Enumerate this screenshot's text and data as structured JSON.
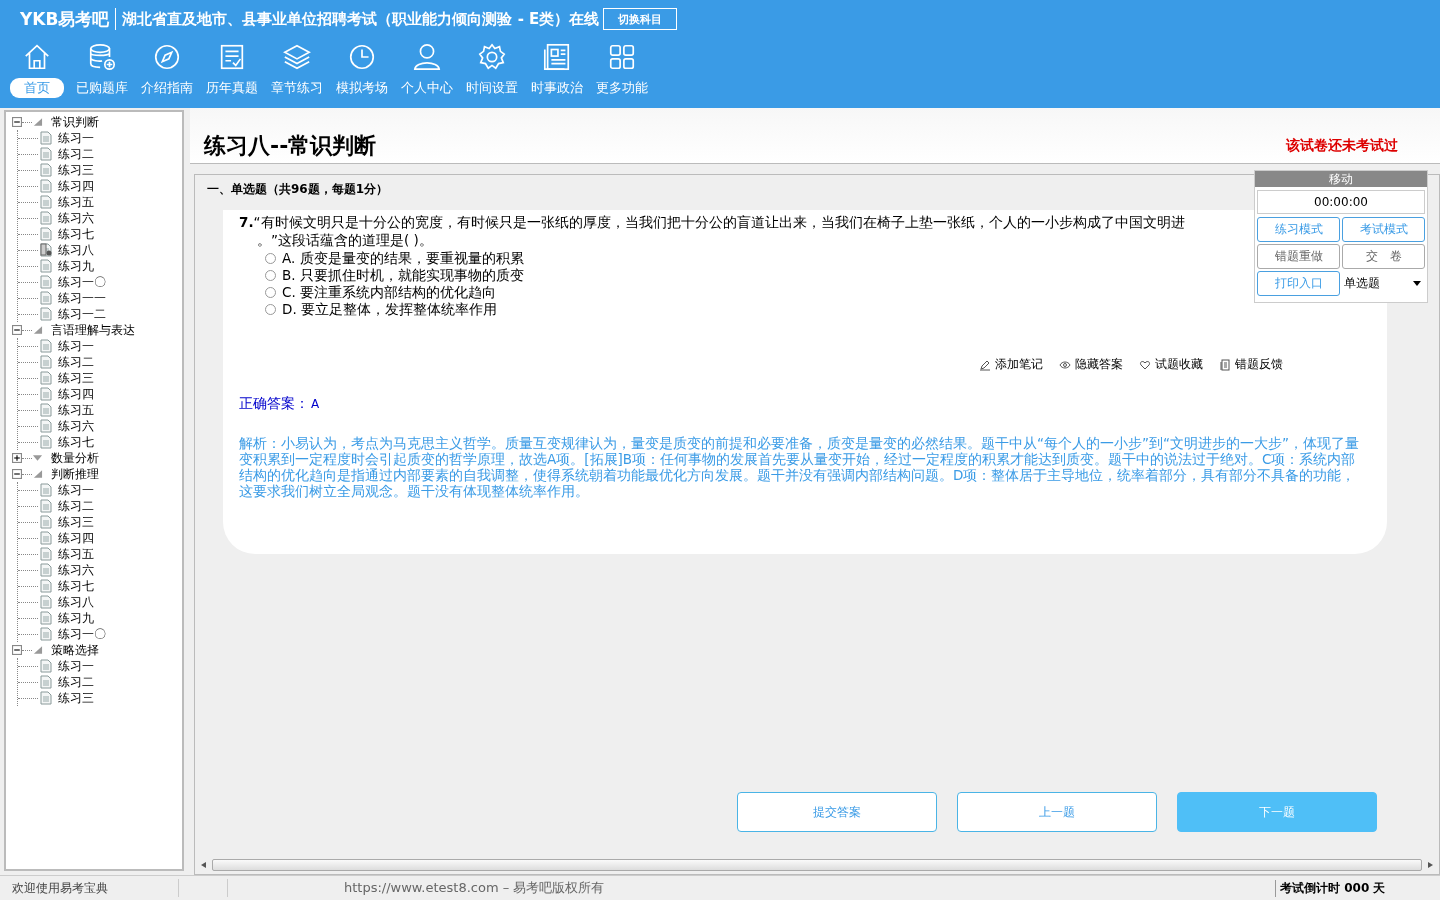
{
  "header": {
    "logo": "YKB易考吧",
    "title": "湖北省直及地市、县事业单位招聘考试（职业能力倾向测验 - E类）在线",
    "switch_button": "切换科目"
  },
  "nav": [
    {
      "label": "首页",
      "selected": true
    },
    {
      "label": "已购题库",
      "selected": false
    },
    {
      "label": "介绍指南",
      "selected": false
    },
    {
      "label": "历年真题",
      "selected": false
    },
    {
      "label": "章节练习",
      "selected": false
    },
    {
      "label": "模拟考场",
      "selected": false
    },
    {
      "label": "个人中心",
      "selected": false
    },
    {
      "label": "时间设置",
      "selected": false
    },
    {
      "label": "时事政治",
      "selected": false
    },
    {
      "label": "更多功能",
      "selected": false
    }
  ],
  "tree": [
    {
      "label": "常识判断",
      "expanded": true,
      "children": [
        {
          "label": "练习一",
          "selected": false
        },
        {
          "label": "练习二",
          "selected": false
        },
        {
          "label": "练习三",
          "selected": false
        },
        {
          "label": "练习四",
          "selected": false
        },
        {
          "label": "练习五",
          "selected": false
        },
        {
          "label": "练习六",
          "selected": false
        },
        {
          "label": "练习七",
          "selected": false
        },
        {
          "label": "练习八",
          "selected": true
        },
        {
          "label": "练习九",
          "selected": false
        },
        {
          "label": "练习一〇",
          "selected": false
        },
        {
          "label": "练习一一",
          "selected": false
        },
        {
          "label": "练习一二",
          "selected": false
        }
      ]
    },
    {
      "label": "言语理解与表达",
      "expanded": true,
      "children": [
        {
          "label": "练习一",
          "selected": false
        },
        {
          "label": "练习二",
          "selected": false
        },
        {
          "label": "练习三",
          "selected": false
        },
        {
          "label": "练习四",
          "selected": false
        },
        {
          "label": "练习五",
          "selected": false
        },
        {
          "label": "练习六",
          "selected": false
        },
        {
          "label": "练习七",
          "selected": false
        }
      ]
    },
    {
      "label": "数量分析",
      "expanded": false
    },
    {
      "label": "判断推理",
      "expanded": true,
      "children": [
        {
          "label": "练习一",
          "selected": false
        },
        {
          "label": "练习二",
          "selected": false
        },
        {
          "label": "练习三",
          "selected": false
        },
        {
          "label": "练习四",
          "selected": false
        },
        {
          "label": "练习五",
          "selected": false
        },
        {
          "label": "练习六",
          "selected": false
        },
        {
          "label": "练习七",
          "selected": false
        },
        {
          "label": "练习八",
          "selected": false
        },
        {
          "label": "练习九",
          "selected": false
        },
        {
          "label": "练习一〇",
          "selected": false
        }
      ]
    },
    {
      "label": "策略选择",
      "expanded": true,
      "children": [
        {
          "label": "练习一",
          "selected": false
        },
        {
          "label": "练习二",
          "selected": false
        },
        {
          "label": "练习三",
          "selected": false
        }
      ]
    }
  ],
  "exam": {
    "title": "练习八--常识判断",
    "status": "该试卷还未考试过",
    "section": "一、单选题（共96题，每题1分）",
    "question": {
      "number": "7.",
      "stem_line1": "“有时候文明只是十分公的宽度，有时候只是一张纸的厚度，当我们把十分公的盲道让出来，当我们在椅子上垫一张纸，个人的一小步构成了中国文明进",
      "stem_line2": "。”这段话蕴含的道理是( )。",
      "options": [
        {
          "text": "A. 质变是量变的结果，要重视量的积累",
          "selected": false
        },
        {
          "text": "B. 只要抓住时机，就能实现事物的质变",
          "selected": false
        },
        {
          "text": "C. 要注重系统内部结构的优化趋向",
          "selected": false
        },
        {
          "text": "D. 要立足整体，发挥整体统率作用",
          "selected": false
        }
      ]
    },
    "tools": [
      "添加笔记",
      "隐藏答案",
      "试题收藏",
      "错题反馈"
    ],
    "answer_label": "正确答案：",
    "answer": "A",
    "analysis": "解析：小易认为，考点为马克思主义哲学。质量互变规律认为，量变是质变的前提和必要准备，质变是量变的必然结果。题干中从“每个人的一小步”到“文明进步的一大步”，体现了量变积累到一定程度时会引起质变的哲学原理，故选A项。[拓展]B项：任何事物的发展首先要从量变开始，经过一定程度的积累才能达到质变。题干中的说法过于绝对。C项：系统内部结构的优化趋向是指通过内部要素的自我调整，使得系统朝着功能最优化方向发展。题干并没有强调内部结构问题。D项：整体居于主导地位，统率着部分，具有部分不具备的功能，这要求我们树立全局观念。题干没有体现整体统率作用。",
    "bottom_buttons": [
      {
        "label": "提交答案",
        "kind": "outline"
      },
      {
        "label": "上一题",
        "kind": "outline"
      },
      {
        "label": "下一题",
        "kind": "filled"
      }
    ]
  },
  "panel": {
    "move": "移动",
    "timer": "00:00:00",
    "buttons": [
      {
        "label": "练习模式",
        "kind": "blue"
      },
      {
        "label": "考试模式",
        "kind": "blue"
      },
      {
        "label": "错题重做",
        "kind": "grey"
      },
      {
        "label": "交　卷",
        "kind": "grey"
      },
      {
        "label": "打印入口",
        "kind": "blue"
      }
    ],
    "type_select": "单选题"
  },
  "status_bar": {
    "welcome": "欢迎使用易考宝典",
    "copyright": "https://www.etest8.com – 易考吧版权所有",
    "countdown": "考试倒计时 000 天"
  }
}
